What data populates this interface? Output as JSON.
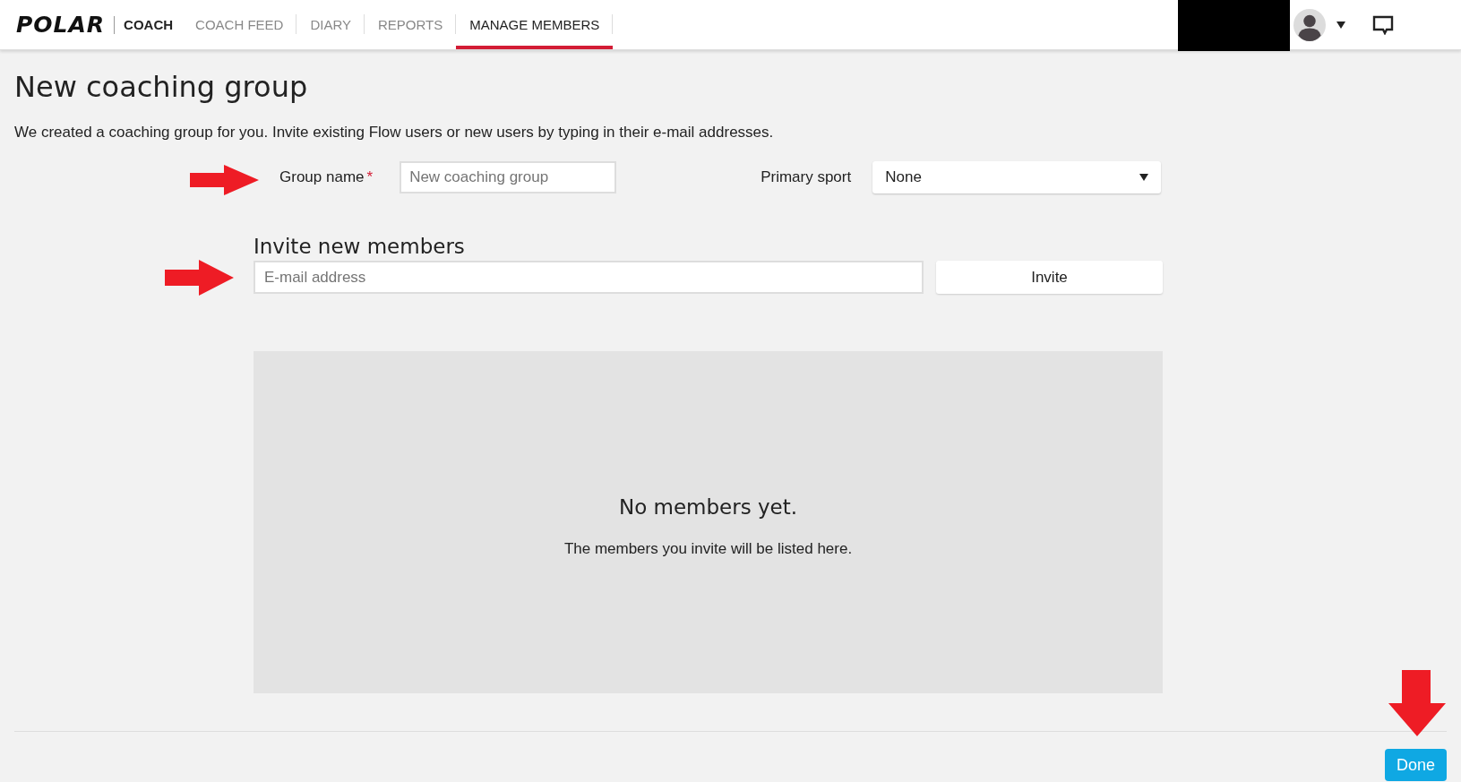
{
  "header": {
    "logo": "POLAR",
    "section": "COACH",
    "tabs": [
      {
        "label": "COACH FEED",
        "selected": false
      },
      {
        "label": "DIARY",
        "selected": false
      },
      {
        "label": "REPORTS",
        "selected": false
      },
      {
        "label": "MANAGE MEMBERS",
        "selected": true
      }
    ]
  },
  "page": {
    "title": "New coaching group",
    "intro": "We created a coaching group for you. Invite existing Flow users or new users by typing in their e-mail addresses."
  },
  "form": {
    "group_name": {
      "label": "Group name",
      "required_mark": "*",
      "placeholder": "New coaching group"
    },
    "primary_sport": {
      "label": "Primary sport",
      "value": "None"
    },
    "invite": {
      "heading": "Invite new members",
      "placeholder": "E-mail address",
      "button": "Invite"
    }
  },
  "members_panel": {
    "title": "No members yet.",
    "message": "The members you invite will be listed here."
  },
  "footer": {
    "button": "Done"
  }
}
